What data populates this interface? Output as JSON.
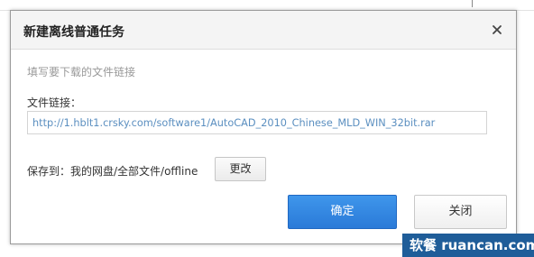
{
  "dialog": {
    "title": "新建离线普通任务",
    "close_icon": "close-icon",
    "hint": "填写要下载的文件链接",
    "url_label": "文件链接：",
    "url_value": "http://1.hblt1.crsky.com/software1/AutoCAD_2010_Chinese_MLD_WIN_32bit.rar",
    "save_label": "保存到：我的网盘/全部文件/offline",
    "change_label": "更改",
    "confirm_label": "确定",
    "cancel_label": "关闭"
  },
  "watermark": {
    "text": "软餐 ruancan.com"
  },
  "colors": {
    "accent": "#2a7ad8",
    "url_text": "#5b8fc0",
    "watermark_bg": "#1f5d99"
  }
}
